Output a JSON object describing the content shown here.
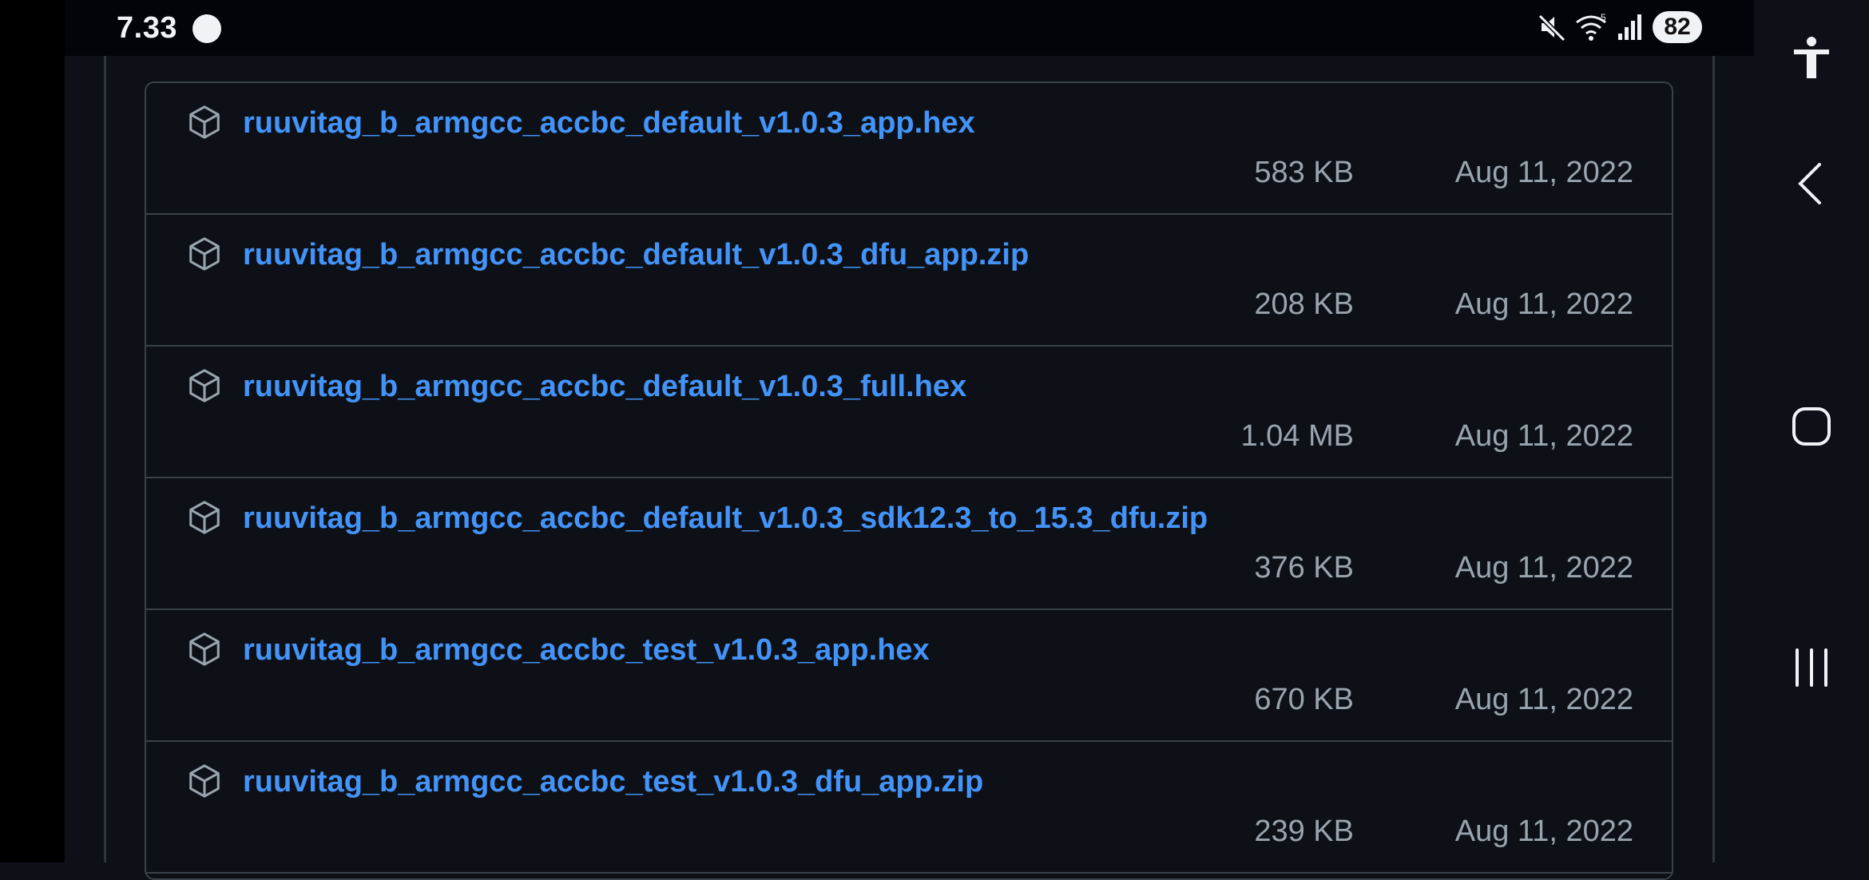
{
  "status_bar": {
    "time": "7.33",
    "battery": "82",
    "icons": [
      "mute-icon",
      "wifi-icon",
      "signal-icon"
    ]
  },
  "assets": [
    {
      "name": "ruuvitag_b_armgcc_accbc_default_v1.0.3_app.hex",
      "size": "583 KB",
      "date": "Aug 11, 2022",
      "icon": "package-icon"
    },
    {
      "name": "ruuvitag_b_armgcc_accbc_default_v1.0.3_dfu_app.zip",
      "size": "208 KB",
      "date": "Aug 11, 2022",
      "icon": "package-icon"
    },
    {
      "name": "ruuvitag_b_armgcc_accbc_default_v1.0.3_full.hex",
      "size": "1.04 MB",
      "date": "Aug 11, 2022",
      "icon": "package-icon"
    },
    {
      "name": "ruuvitag_b_armgcc_accbc_default_v1.0.3_sdk12.3_to_15.3_dfu.zip",
      "size": "376 KB",
      "date": "Aug 11, 2022",
      "icon": "package-icon"
    },
    {
      "name": "ruuvitag_b_armgcc_accbc_test_v1.0.3_app.hex",
      "size": "670 KB",
      "date": "Aug 11, 2022",
      "icon": "package-icon"
    },
    {
      "name": "ruuvitag_b_armgcc_accbc_test_v1.0.3_dfu_app.zip",
      "size": "239 KB",
      "date": "Aug 11, 2022",
      "icon": "package-icon"
    }
  ],
  "nav_buttons": [
    "accessibility-icon",
    "back-icon",
    "home-icon",
    "recents-icon"
  ],
  "colors": {
    "background": "#0d1117",
    "link": "#4493f8",
    "muted_text": "#9aa4af",
    "border": "#3a414a"
  }
}
